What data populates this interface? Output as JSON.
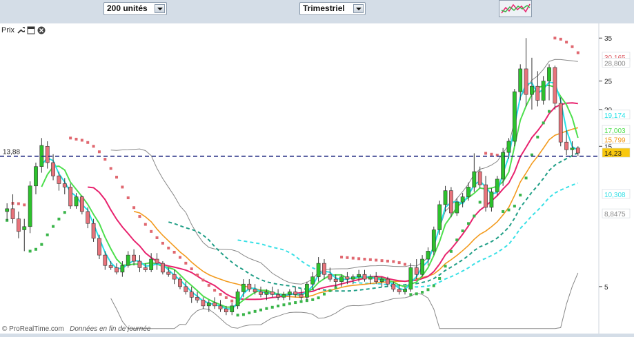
{
  "toolbar": {
    "units_select": "200 unités",
    "period_select": "Trimestriel",
    "indicators_icon": "indicators-icon"
  },
  "panel": {
    "title": "Prix",
    "icons": [
      "wrench-icon",
      "window-icon",
      "close-icon"
    ]
  },
  "footer": {
    "copyright": "© ProRealTime.com",
    "note": "Données en fin de journée"
  },
  "colors": {
    "up_candle": "#2cc22c",
    "down_candle": "#e8737b",
    "sar": "#3ab54a",
    "sar_down": "#e06870",
    "bollinger": "#888888",
    "ma_fast": "#26e2e8",
    "ma_green": "#4ddf4d",
    "ma_pink": "#e8226e",
    "ma_orange": "#f39a1c",
    "ma_dash_teal": "#1f9e86",
    "ma_dash_cyan": "#38e0e6",
    "last_price_line": "#1a237e"
  },
  "chart_data": {
    "type": "candlestick",
    "y_axis": {
      "scale": "log",
      "ticks": [
        "35",
        "25",
        "20",
        "15",
        "5"
      ],
      "ylim": [
        3.5,
        38
      ]
    },
    "last_price_line": "13,88",
    "value_tags": [
      {
        "label": "30,165",
        "color": "#e06870"
      },
      {
        "label": "28,800",
        "color": "#888888"
      },
      {
        "label": "19,174",
        "color": "#26e2e8"
      },
      {
        "label": "17,003",
        "color": "#4ddf4d"
      },
      {
        "label": "15,799",
        "color": "#f39a1c"
      },
      {
        "label": "14,23",
        "color": "#f9c80e"
      },
      {
        "label": "10,308",
        "color": "#38e0e6"
      },
      {
        "label": "8,8475",
        "color": "#888888"
      }
    ],
    "candles": [
      [
        9.0,
        9.6,
        8.4,
        9.2
      ],
      [
        9.2,
        10.3,
        8.2,
        8.5
      ],
      [
        8.5,
        9.0,
        7.3,
        7.7
      ],
      [
        7.8,
        8.5,
        6.6,
        8.0
      ],
      [
        8.0,
        11.4,
        7.6,
        11.0
      ],
      [
        11.0,
        13.2,
        10.3,
        12.8
      ],
      [
        12.8,
        16.0,
        12.2,
        15.1
      ],
      [
        15.0,
        15.6,
        12.6,
        13.2
      ],
      [
        13.2,
        14.1,
        11.5,
        11.9
      ],
      [
        11.9,
        12.3,
        10.6,
        11.2
      ],
      [
        11.2,
        11.7,
        10.3,
        10.9
      ],
      [
        10.9,
        11.2,
        9.2,
        9.4
      ],
      [
        9.4,
        10.4,
        9.2,
        10.1
      ],
      [
        10.1,
        10.2,
        8.8,
        9.0
      ],
      [
        9.0,
        9.3,
        7.9,
        8.2
      ],
      [
        8.2,
        8.5,
        7.1,
        7.3
      ],
      [
        7.3,
        7.5,
        6.2,
        6.4
      ],
      [
        6.4,
        6.6,
        5.7,
        5.9
      ],
      [
        5.9,
        6.1,
        5.7,
        5.8
      ],
      [
        5.8,
        6.0,
        5.5,
        5.6
      ],
      [
        5.6,
        6.1,
        5.4,
        5.9
      ],
      [
        5.9,
        6.6,
        5.8,
        6.4
      ],
      [
        6.4,
        6.7,
        5.9,
        6.1
      ],
      [
        6.1,
        6.4,
        5.6,
        5.8
      ],
      [
        5.8,
        6.0,
        5.6,
        5.7
      ],
      [
        5.7,
        6.5,
        5.6,
        6.2
      ],
      [
        6.2,
        6.5,
        5.7,
        6.0
      ],
      [
        6.0,
        6.1,
        5.5,
        5.6
      ],
      [
        5.6,
        5.8,
        5.4,
        5.5
      ],
      [
        5.5,
        5.7,
        5.1,
        5.3
      ],
      [
        5.3,
        5.4,
        4.9,
        5.0
      ],
      [
        5.0,
        5.2,
        4.7,
        4.8
      ],
      [
        4.8,
        5.0,
        4.4,
        4.6
      ],
      [
        4.6,
        4.8,
        4.4,
        4.5
      ],
      [
        4.5,
        4.6,
        4.2,
        4.3
      ],
      [
        4.3,
        4.5,
        4.1,
        4.4
      ],
      [
        4.4,
        4.6,
        4.2,
        4.3
      ],
      [
        4.3,
        4.5,
        4.1,
        4.2
      ],
      [
        4.2,
        4.3,
        4.0,
        4.1
      ],
      [
        4.1,
        4.4,
        4.0,
        4.3
      ],
      [
        4.3,
        4.9,
        4.2,
        4.8
      ],
      [
        4.8,
        5.3,
        4.6,
        5.1
      ],
      [
        5.1,
        5.3,
        4.8,
        4.9
      ],
      [
        4.9,
        5.1,
        4.7,
        4.8
      ],
      [
        4.8,
        5.0,
        4.6,
        4.7
      ],
      [
        4.7,
        4.9,
        4.5,
        4.8
      ],
      [
        4.8,
        5.0,
        4.6,
        4.7
      ],
      [
        4.7,
        4.9,
        4.5,
        4.6
      ],
      [
        4.6,
        4.8,
        4.5,
        4.7
      ],
      [
        4.7,
        4.9,
        4.5,
        4.8
      ],
      [
        4.8,
        5.0,
        4.6,
        4.7
      ],
      [
        4.7,
        4.9,
        4.5,
        4.6
      ],
      [
        4.6,
        5.2,
        4.5,
        5.1
      ],
      [
        5.1,
        5.6,
        4.9,
        5.4
      ],
      [
        5.4,
        6.3,
        5.2,
        6.0
      ],
      [
        6.0,
        6.2,
        5.3,
        5.5
      ],
      [
        5.5,
        5.8,
        5.2,
        5.3
      ],
      [
        5.3,
        5.5,
        5.0,
        5.2
      ],
      [
        5.2,
        5.5,
        5.0,
        5.4
      ],
      [
        5.4,
        5.6,
        5.1,
        5.3
      ],
      [
        5.3,
        5.5,
        5.1,
        5.4
      ],
      [
        5.4,
        5.7,
        5.2,
        5.5
      ],
      [
        5.5,
        5.7,
        5.2,
        5.3
      ],
      [
        5.3,
        5.5,
        5.1,
        5.4
      ],
      [
        5.4,
        5.6,
        5.1,
        5.2
      ],
      [
        5.2,
        5.4,
        5.0,
        5.3
      ],
      [
        5.3,
        5.4,
        5.0,
        5.1
      ],
      [
        5.1,
        5.2,
        4.8,
        4.9
      ],
      [
        4.9,
        5.1,
        4.7,
        4.8
      ],
      [
        4.8,
        5.0,
        4.7,
        4.9
      ],
      [
        4.9,
        6.0,
        4.8,
        5.8
      ],
      [
        5.8,
        6.2,
        5.3,
        5.5
      ],
      [
        5.5,
        6.4,
        5.4,
        6.2
      ],
      [
        6.2,
        6.8,
        5.9,
        6.6
      ],
      [
        6.6,
        8.0,
        6.4,
        7.8
      ],
      [
        7.8,
        9.8,
        7.5,
        9.5
      ],
      [
        9.5,
        11.0,
        9.0,
        10.6
      ],
      [
        10.6,
        10.9,
        8.6,
        8.9
      ],
      [
        8.9,
        10.0,
        8.7,
        9.7
      ],
      [
        9.7,
        10.4,
        9.3,
        10.1
      ],
      [
        10.1,
        11.3,
        9.8,
        10.9
      ],
      [
        10.9,
        14.2,
        10.5,
        12.3
      ],
      [
        12.3,
        12.8,
        10.8,
        11.1
      ],
      [
        11.1,
        11.9,
        9.0,
        9.3
      ],
      [
        9.3,
        10.8,
        9.0,
        10.5
      ],
      [
        10.5,
        11.9,
        10.2,
        11.6
      ],
      [
        11.6,
        14.8,
        11.0,
        14.3
      ],
      [
        14.3,
        16.0,
        13.6,
        15.6
      ],
      [
        15.6,
        23.5,
        15.0,
        23.0
      ],
      [
        23.0,
        28.5,
        21.5,
        27.5
      ],
      [
        27.5,
        35.0,
        20.5,
        22.5
      ],
      [
        22.5,
        30.0,
        20.0,
        24.0
      ],
      [
        24.0,
        27.0,
        20.5,
        21.5
      ],
      [
        21.5,
        26.0,
        20.8,
        25.0
      ],
      [
        25.0,
        28.5,
        21.5,
        27.8
      ],
      [
        27.8,
        28.2,
        20.0,
        21.0
      ],
      [
        21.0,
        22.0,
        15.0,
        15.5
      ],
      [
        15.5,
        17.0,
        14.0,
        14.6
      ],
      [
        14.6,
        15.6,
        13.8,
        14.8
      ],
      [
        14.8,
        15.0,
        13.9,
        14.23
      ]
    ]
  }
}
